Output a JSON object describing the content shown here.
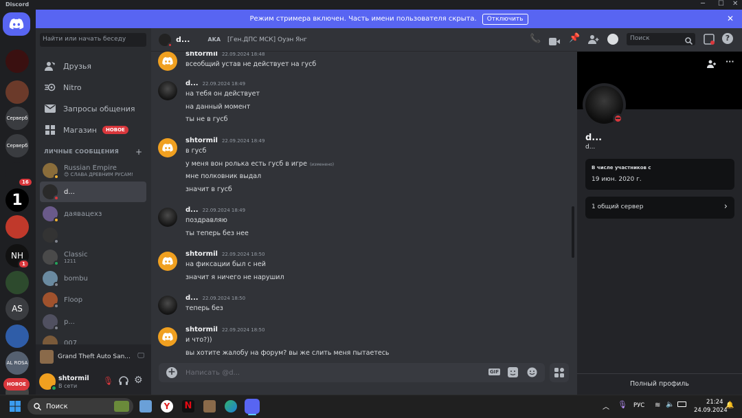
{
  "window": {
    "title": "Discord"
  },
  "banner": {
    "text": "Режим стримера включен. Часть имени пользователя скрыта.",
    "button": "Отключить"
  },
  "servers": {
    "items": [
      {
        "label": "",
        "color": "#5865f2"
      },
      {
        "label": "",
        "color": "#3a1010"
      },
      {
        "label": "",
        "color": "#6b3a2a"
      },
      {
        "label": "Серверб",
        "color": "#3a3c40"
      },
      {
        "label": "Серверб",
        "color": "#3a3c40"
      },
      {
        "label": "",
        "color": "#1e1f22",
        "badge": "16"
      },
      {
        "label": "1",
        "color": "#000000"
      },
      {
        "label": "",
        "color": "#c0392b"
      },
      {
        "label": "NH",
        "color": "#111111",
        "badge": "1"
      },
      {
        "label": "",
        "color": "#2d4a2d"
      },
      {
        "label": "AS",
        "color": "#3a3c40"
      },
      {
        "label": "",
        "color": "#2f5da8"
      },
      {
        "label": "AL ROSA",
        "color": "#556070"
      },
      {
        "label": "",
        "color": "#444"
      }
    ],
    "new_label": "НОВОЕ"
  },
  "dm": {
    "search_placeholder": "Найти или начать беседу",
    "nav": [
      {
        "label": "Друзья"
      },
      {
        "label": "Nitro"
      },
      {
        "label": "Запросы общения"
      },
      {
        "label": "Магазин",
        "badge": "НОВОЕ"
      }
    ],
    "section_title": "ЛИЧНЫЕ СООБЩЕНИЯ",
    "add": "+",
    "list": [
      {
        "name": "Russian Empire",
        "sub": "😊 СЛАВА ДРЕВНИМ РУСАМ!",
        "color": "#8a6d3b",
        "status": "#f0b232"
      },
      {
        "name": "d...",
        "sub": "",
        "color": "#2a2a2a",
        "status": "#da373c",
        "active": true
      },
      {
        "name": "даявацехз",
        "sub": "",
        "color": "#6a5a8a",
        "status": "#f0b232"
      },
      {
        "name": "",
        "sub": "",
        "color": "#333333",
        "status": "#80848e"
      },
      {
        "name": "Classic",
        "sub": "1211",
        "color": "#4a4a4a",
        "status": "#23a55a"
      },
      {
        "name": "bombu",
        "sub": "",
        "color": "#6a8aa0",
        "status": "#80848e"
      },
      {
        "name": "Floop",
        "sub": "",
        "color": "#a0522d",
        "status": "#80848e"
      },
      {
        "name": "p...",
        "sub": "",
        "color": "#505060",
        "status": "#80848e"
      },
      {
        "name": "007",
        "sub": "",
        "color": "#7a5a3a",
        "status": "#80848e"
      }
    ]
  },
  "activity": {
    "game": "Grand Theft Auto San..."
  },
  "user": {
    "name": "shtormil",
    "status": "В сети"
  },
  "chat_header": {
    "name": "d...",
    "aka_label": "AKA",
    "aka_value": "[Ген.ДПС МСК] Оуэн Янг",
    "search_placeholder": "Поиск"
  },
  "messages": [
    {
      "author": "shtormil",
      "time": "22.09.2024 18:48",
      "bot": true,
      "lines": [
        "всеобщий устав не действует на гусб"
      ]
    },
    {
      "author": "d...",
      "time": "22.09.2024 18:49",
      "bot": false,
      "lines": [
        "на тебя он действует",
        "на данный момент",
        "ты не в гусб"
      ]
    },
    {
      "author": "shtormil",
      "time": "22.09.2024 18:49",
      "bot": true,
      "lines": [
        "в гусб",
        "у меня вон ролька есть гусб в игре",
        "мне полковник выдал",
        "значит в гусб"
      ],
      "edited": "(изменено)"
    },
    {
      "author": "d...",
      "time": "22.09.2024 18:49",
      "bot": false,
      "lines": [
        "поздравляю",
        "ты теперь без нее"
      ]
    },
    {
      "author": "shtormil",
      "time": "22.09.2024 18:50",
      "bot": true,
      "lines": [
        "на фиксации был с ней",
        "значит я ничего не нарушил"
      ]
    },
    {
      "author": "d...",
      "time": "22.09.2024 18:50",
      "bot": false,
      "lines": [
        "теперь без"
      ]
    },
    {
      "author": "shtormil",
      "time": "22.09.2024 18:50",
      "bot": true,
      "lines": [
        "и что?))",
        "вы хотите жалобу на форум? вы же слить меня пытаетесь"
      ]
    }
  ],
  "composer": {
    "placeholder": "Написать @d...",
    "gif": "GIF"
  },
  "profile": {
    "name": "d...",
    "username": "d...",
    "member_since_label": "В числе участников с",
    "member_since_value": "19 июн. 2020 г.",
    "mutual_servers": "1 общий сервер",
    "full_profile": "Полный профиль"
  },
  "taskbar": {
    "search": "Поиск",
    "lang": "РУС",
    "time": "21:24",
    "date": "24.09.2024"
  }
}
